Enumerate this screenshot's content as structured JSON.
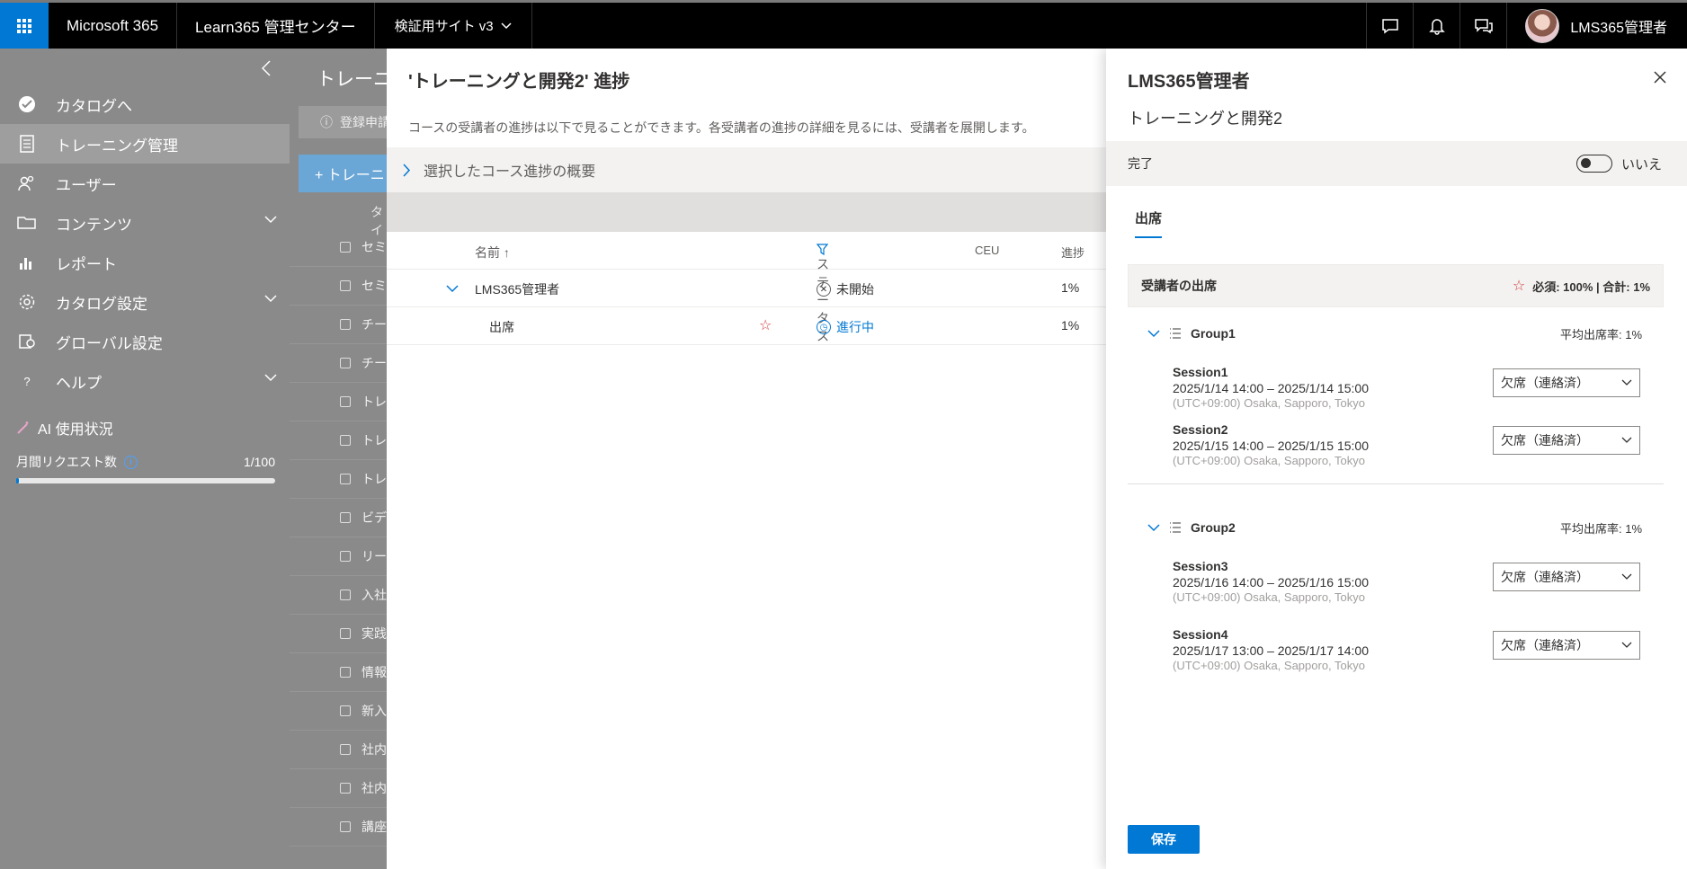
{
  "topbar": {
    "brand": "Microsoft 365",
    "app_name": "Learn365 管理センター",
    "site": "検証用サイト v3",
    "user": "LMS365管理者"
  },
  "leftnav": {
    "items": [
      {
        "label": "カタログへ",
        "icon": "check-circle-icon"
      },
      {
        "label": "トレーニング管理",
        "icon": "document-list-icon"
      },
      {
        "label": "ユーザー",
        "icon": "people-icon"
      },
      {
        "label": "コンテンツ",
        "icon": "folder-open-icon"
      },
      {
        "label": "レポート",
        "icon": "bar-chart-icon"
      },
      {
        "label": "カタログ設定",
        "icon": "gear-icon"
      },
      {
        "label": "グローバル設定",
        "icon": "global-settings-icon"
      },
      {
        "label": "ヘルプ",
        "icon": "question-icon"
      }
    ],
    "ai_usage_label": "AI 使用状況",
    "monthly_requests_label": "月間リクエスト数",
    "monthly_requests_value": "1/100",
    "monthly_requests_fraction": 0.01
  },
  "background_page": {
    "title": "トレーニ",
    "notice": "登録申請",
    "new_button": "+ トレーニ",
    "column_header": "タイ",
    "rows": [
      "セミ",
      "セミ",
      "チー",
      "チー",
      "トレ",
      "トレ",
      "トレ",
      "ビデ",
      "リー",
      "入社",
      "実践",
      "情報",
      "新入",
      "社内",
      "社内",
      "講座"
    ]
  },
  "middle_panel": {
    "title": "'トレーニングと開発2' 進捗",
    "description": "コースの受講者の進捗は以下で見ることができます。各受講者の進捗の詳細を見るには、受講者を展開します。",
    "summary_label": "選択したコース進捗の概要",
    "columns": {
      "name": "名前 ↑",
      "status": "ステータス",
      "ceu": "CEU",
      "progress": "進捗"
    },
    "rows": [
      {
        "name": "LMS365管理者",
        "status": "未開始",
        "progress": "1%"
      },
      {
        "name": "出席",
        "status": "進行中",
        "progress": "1%"
      }
    ]
  },
  "right_panel": {
    "title": "LMS365管理者",
    "subtitle": "トレーニングと開発2",
    "complete_label": "完了",
    "toggle_label": "いいえ",
    "tab": "出席",
    "attendance_header": "受講者の出席",
    "attendance_summary": "必須: 100% | 合計: 1%",
    "groups": [
      {
        "name": "Group1",
        "avg": "平均出席率: 1%",
        "sessions": [
          {
            "name": "Session1",
            "datetime": "2025/1/14 14:00 – 2025/1/14 15:00",
            "tz": "(UTC+09:00) Osaka, Sapporo, Tokyo",
            "value": "欠席（連絡済）"
          },
          {
            "name": "Session2",
            "datetime": "2025/1/15 14:00 – 2025/1/15 15:00",
            "tz": "(UTC+09:00) Osaka, Sapporo, Tokyo",
            "value": "欠席（連絡済）"
          }
        ]
      },
      {
        "name": "Group2",
        "avg": "平均出席率: 1%",
        "sessions": [
          {
            "name": "Session3",
            "datetime": "2025/1/16 14:00 – 2025/1/16 15:00",
            "tz": "(UTC+09:00) Osaka, Sapporo, Tokyo",
            "value": "欠席（連絡済）"
          },
          {
            "name": "Session4",
            "datetime": "2025/1/17 13:00 – 2025/1/17 14:00",
            "tz": "(UTC+09:00) Osaka, Sapporo, Tokyo",
            "value": "欠席（連絡済）"
          }
        ]
      }
    ],
    "save_button": "保存"
  },
  "colors": {
    "accent": "#0078d4",
    "star": "#d13438",
    "nav_bg": "#8a8a8a"
  }
}
